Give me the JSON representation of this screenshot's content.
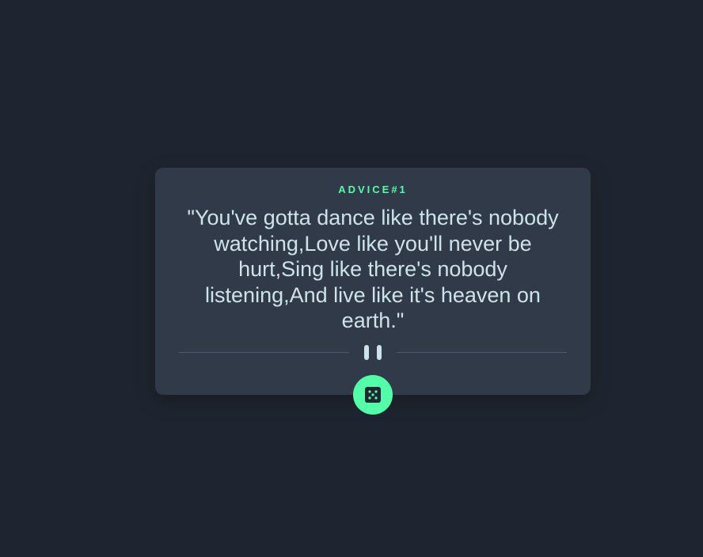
{
  "advice": {
    "label": "ADVICE#1",
    "quote": "\"You've gotta dance like there's nobody watching,Love like you'll never be hurt,Sing like there's nobody listening,And live like it's heaven on earth.\""
  },
  "icons": {
    "divider": "pause-icon",
    "button": "dice-icon"
  },
  "colors": {
    "background": "#1f2530",
    "card": "#313a49",
    "accent": "#52ffa8",
    "text": "#cee3e9"
  }
}
